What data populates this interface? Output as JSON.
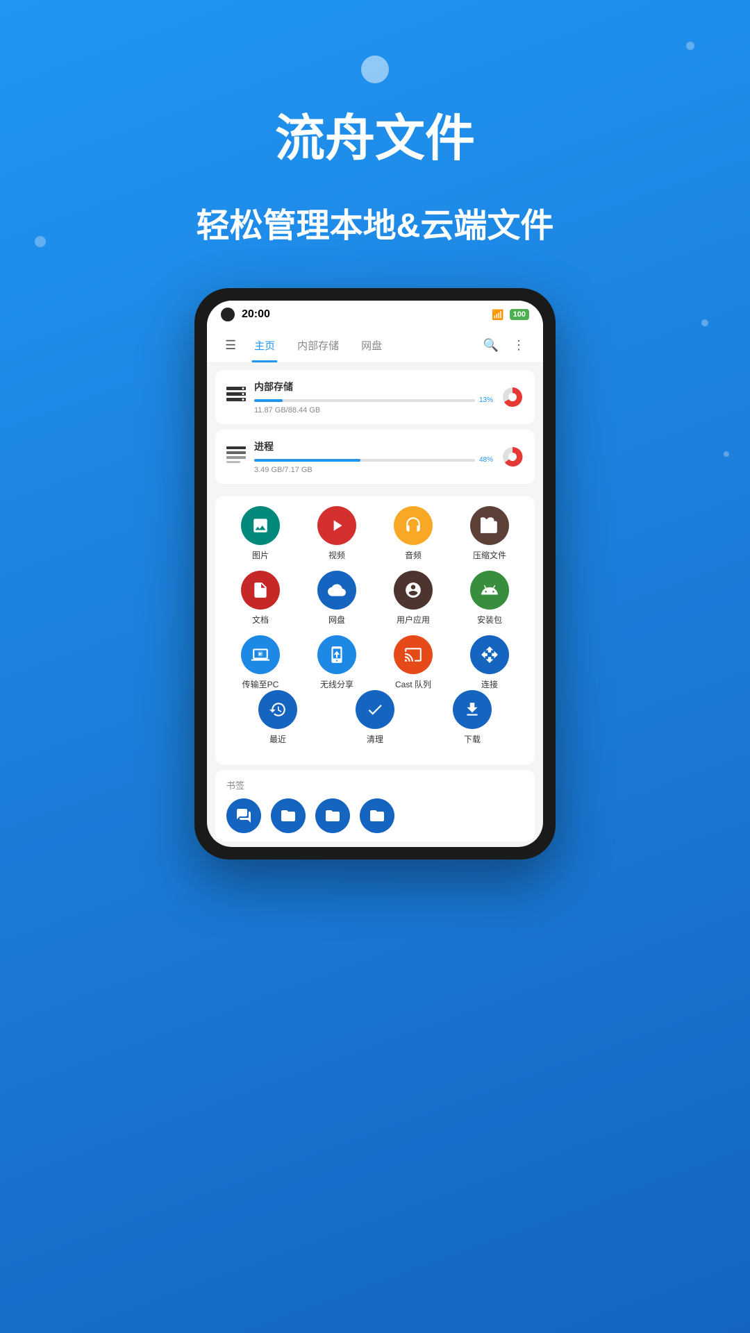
{
  "app": {
    "title": "流舟文件",
    "subtitle": "轻松管理本地&云端文件"
  },
  "status_bar": {
    "time": "20:00",
    "battery_label": "100"
  },
  "nav": {
    "menu_icon": "☰",
    "tabs": [
      {
        "label": "主页",
        "active": true
      },
      {
        "label": "内部存储",
        "active": false
      },
      {
        "label": "网盘",
        "active": false
      }
    ],
    "search_icon": "🔍",
    "more_icon": "⋮"
  },
  "storage": {
    "internal": {
      "name": "内部存储",
      "percent": 13,
      "percent_label": "13%",
      "size_label": "11.87 GB/88.44 GB",
      "color": "#2196F3"
    },
    "process": {
      "name": "进程",
      "percent": 48,
      "percent_label": "48%",
      "size_label": "3.49 GB/7.17 GB",
      "color": "#2196F3"
    }
  },
  "apps": {
    "grid": [
      {
        "label": "图片",
        "color": "#00897B",
        "icon": "🖼"
      },
      {
        "label": "视频",
        "color": "#D32F2F",
        "icon": "▶"
      },
      {
        "label": "音频",
        "color": "#F9A825",
        "icon": "🎧"
      },
      {
        "label": "压缩文件",
        "color": "#5D4037",
        "icon": "📥"
      },
      {
        "label": "文档",
        "color": "#C62828",
        "icon": "📄"
      },
      {
        "label": "网盘",
        "color": "#1565C0",
        "icon": "☁"
      },
      {
        "label": "用户应用",
        "color": "#4E342E",
        "icon": "👾"
      },
      {
        "label": "安装包",
        "color": "#388E3C",
        "icon": "🤖"
      },
      {
        "label": "传输至PC",
        "color": "#1E88E5",
        "icon": "💻"
      },
      {
        "label": "无线分享",
        "color": "#1E88E5",
        "icon": "📱"
      },
      {
        "label": "Cast 队列",
        "color": "#E64A19",
        "icon": "📡"
      },
      {
        "label": "连接",
        "color": "#1565C0",
        "icon": "↔"
      }
    ],
    "bottom": [
      {
        "label": "最近",
        "color": "#1565C0",
        "icon": "🕐"
      },
      {
        "label": "清理",
        "color": "#1565C0",
        "icon": "✔"
      },
      {
        "label": "下载",
        "color": "#1565C0",
        "icon": "⬇"
      }
    ]
  },
  "bookmarks": {
    "title": "书签",
    "items": [
      "📁",
      "📁",
      "📁",
      "📁"
    ]
  }
}
